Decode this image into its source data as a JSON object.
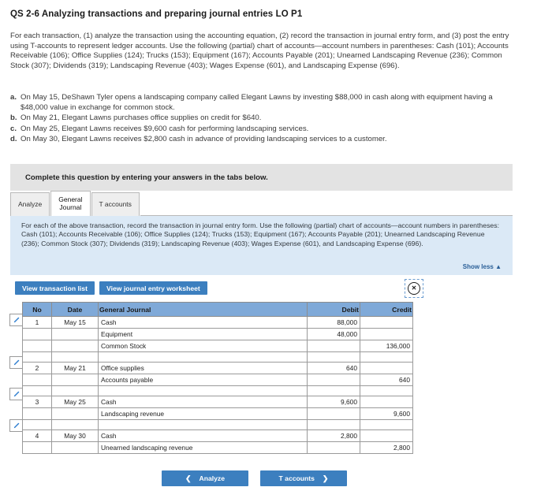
{
  "question": {
    "title": "QS 2-6 Analyzing transactions and preparing journal entries LO P1",
    "intro": "For each transaction, (1) analyze the transaction using the accounting equation, (2) record the transaction in journal entry form, and (3) post the entry using T-accounts to represent ledger accounts. Use the following (partial) chart of accounts—account numbers in parentheses: Cash (101); Accounts Receivable (106); Office Supplies (124); Trucks (153); Equipment (167); Accounts Payable (201); Unearned Landscaping Revenue (236); Common Stock (307); Dividends (319); Landscaping Revenue (403); Wages Expense (601), and Landscaping Expense (696).",
    "items": [
      {
        "letter": "a.",
        "text": "On May 15, DeShawn Tyler opens a landscaping company called Elegant Lawns by investing $88,000 in cash along with equipment having a $48,000 value in exchange for common stock."
      },
      {
        "letter": "b.",
        "text": "On May 21, Elegant Lawns purchases office supplies on credit for $640."
      },
      {
        "letter": "c.",
        "text": "On May 25, Elegant Lawns receives $9,600 cash for performing landscaping services."
      },
      {
        "letter": "d.",
        "text": "On May 30, Elegant Lawns receives $2,800 cash in advance of providing landscaping services to a customer."
      }
    ]
  },
  "banner": {
    "text": "Complete this question by entering your answers in the tabs below."
  },
  "tabs": [
    {
      "label": "Analyze",
      "active": false
    },
    {
      "label": "General Journal",
      "active": true
    },
    {
      "label": "T accounts",
      "active": false
    }
  ],
  "tab_labels": {
    "analyze": "Analyze",
    "general_journal_line1": "General",
    "general_journal_line2": "Journal",
    "t_accounts": "T accounts"
  },
  "info_panel": {
    "text": "For each of the above transaction, record the transaction in journal entry form. Use the following (partial) chart of accounts—account numbers in parentheses: Cash (101); Accounts Receivable (106); Office Supplies (124); Trucks (153); Equipment (167); Accounts Payable (201); Unearned Landscaping Revenue (236); Common Stock (307); Dividends (319); Landscaping Revenue (403); Wages Expense (601), and Landscaping Expense (696).",
    "show_less": "Show less ▲"
  },
  "toolbar": {
    "view_transaction_list": "View transaction list",
    "view_journal_entry_worksheet": "View journal entry worksheet",
    "close_icon_glyph": "✕"
  },
  "journal": {
    "headers": [
      "No",
      "Date",
      "General Journal",
      "Debit",
      "Credit"
    ],
    "rows": [
      {
        "kind": "entry",
        "pencil": true,
        "no": "1",
        "date": "May 15",
        "account": "Cash",
        "indent": false,
        "debit": "88,000",
        "credit": ""
      },
      {
        "kind": "line",
        "pencil": false,
        "no": "",
        "date": "",
        "account": "Equipment",
        "indent": false,
        "debit": "48,000",
        "credit": ""
      },
      {
        "kind": "line",
        "pencil": false,
        "no": "",
        "date": "",
        "account": "Common Stock",
        "indent": true,
        "debit": "",
        "credit": "136,000"
      },
      {
        "kind": "blank",
        "pencil": false,
        "no": "",
        "date": "",
        "account": "",
        "indent": false,
        "debit": "",
        "credit": ""
      },
      {
        "kind": "entry",
        "pencil": true,
        "no": "2",
        "date": "May 21",
        "account": "Office supplies",
        "indent": false,
        "debit": "640",
        "credit": ""
      },
      {
        "kind": "line",
        "pencil": false,
        "no": "",
        "date": "",
        "account": "Accounts payable",
        "indent": true,
        "debit": "",
        "credit": "640"
      },
      {
        "kind": "blank",
        "pencil": false,
        "no": "",
        "date": "",
        "account": "",
        "indent": false,
        "debit": "",
        "credit": ""
      },
      {
        "kind": "entry",
        "pencil": true,
        "no": "3",
        "date": "May 25",
        "account": "Cash",
        "indent": false,
        "debit": "9,600",
        "credit": ""
      },
      {
        "kind": "line",
        "pencil": false,
        "no": "",
        "date": "",
        "account": "Landscaping revenue",
        "indent": true,
        "debit": "",
        "credit": "9,600"
      },
      {
        "kind": "blank",
        "pencil": false,
        "no": "",
        "date": "",
        "account": "",
        "indent": false,
        "debit": "",
        "credit": ""
      },
      {
        "kind": "entry",
        "pencil": true,
        "no": "4",
        "date": "May 30",
        "account": "Cash",
        "indent": false,
        "debit": "2,800",
        "credit": ""
      },
      {
        "kind": "line",
        "pencil": false,
        "no": "",
        "date": "",
        "account": "Unearned landscaping revenue",
        "indent": true,
        "debit": "",
        "credit": "2,800"
      }
    ]
  },
  "footer_nav": {
    "prev_label": "Analyze",
    "prev_chevron": "❮",
    "next_label": "T accounts",
    "next_chevron": "❯"
  },
  "colors": {
    "accent_blue": "#3c7fbf",
    "table_header_blue": "#7fa9d8",
    "info_panel_blue": "#dbe9f6",
    "banner_gray": "#e3e3e3",
    "link_blue": "#2a5f97"
  }
}
